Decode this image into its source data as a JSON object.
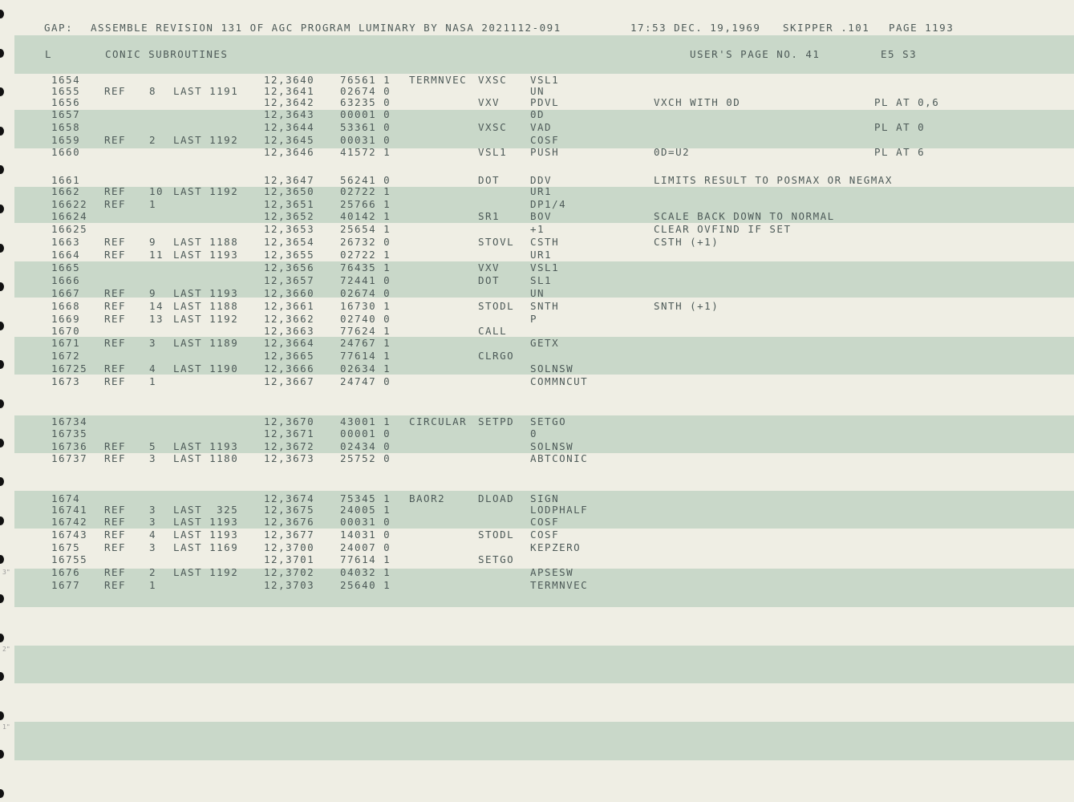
{
  "header": {
    "prefix": "GAP:",
    "assembly": "ASSEMBLE REVISION 131 OF AGC PROGRAM LUMINARY BY NASA 2021112-091",
    "timestamp": "17:53 DEC. 19,1969",
    "skipper": "SKIPPER .101",
    "page": "PAGE 1193"
  },
  "subheader": {
    "l": "L",
    "section": "CONIC SUBROUTINES",
    "user_page": "USER'S PAGE NO. 41",
    "code": "E5 S3"
  },
  "margin_ticks": [
    "3\"",
    "2\"",
    "1\""
  ],
  "rows": [
    {
      "n": "1654",
      "ref": "",
      "rn": "",
      "last": "",
      "addr": "12,3640",
      "oct": "76561 1",
      "label": "TERMNVEC",
      "op": "VXSC",
      "operand": "VSL1",
      "comment": "",
      "pl": ""
    },
    {
      "n": "1655",
      "ref": "REF",
      "rn": "8",
      "last": "LAST 1191",
      "addr": "12,3641",
      "oct": "02674 0",
      "label": "",
      "op": "",
      "operand": "UN",
      "comment": "",
      "pl": ""
    },
    {
      "n": "1656",
      "ref": "",
      "rn": "",
      "last": "",
      "addr": "12,3642",
      "oct": "63235 0",
      "label": "",
      "op": "VXV",
      "operand": "PDVL",
      "comment": "VXCH WITH 0D",
      "pl": "PL AT 0,6"
    },
    {
      "n": "1657",
      "ref": "",
      "rn": "",
      "last": "",
      "addr": "12,3643",
      "oct": "00001 0",
      "label": "",
      "op": "",
      "operand": "0D",
      "comment": "",
      "pl": ""
    },
    {
      "n": "1658",
      "ref": "",
      "rn": "",
      "last": "",
      "addr": "12,3644",
      "oct": "53361 0",
      "label": "",
      "op": "VXSC",
      "operand": "VAD",
      "comment": "",
      "pl": "PL AT 0"
    },
    {
      "n": "1659",
      "ref": "REF",
      "rn": "2",
      "last": "LAST 1192",
      "addr": "12,3645",
      "oct": "00031 0",
      "label": "",
      "op": "",
      "operand": "COSF",
      "comment": "",
      "pl": ""
    },
    {
      "n": "1660",
      "ref": "",
      "rn": "",
      "last": "",
      "addr": "12,3646",
      "oct": "41572 1",
      "label": "",
      "op": "VSL1",
      "operand": "PUSH",
      "comment": "0D=U2",
      "pl": "PL AT 6"
    },
    {
      "n": "1661",
      "ref": "",
      "rn": "",
      "last": "",
      "addr": "12,3647",
      "oct": "56241 0",
      "label": "",
      "op": "DOT",
      "operand": "DDV",
      "comment": "LIMITS RESULT TO POSMAX OR NEGMAX",
      "pl": ""
    },
    {
      "n": "1662",
      "ref": "REF",
      "rn": "10",
      "last": "LAST 1192",
      "addr": "12,3650",
      "oct": "02722 1",
      "label": "",
      "op": "",
      "operand": "UR1",
      "comment": "",
      "pl": ""
    },
    {
      "n": "16622",
      "ref": "REF",
      "rn": "1",
      "last": "",
      "addr": "12,3651",
      "oct": "25766 1",
      "label": "",
      "op": "",
      "operand": "DP1/4",
      "comment": "",
      "pl": ""
    },
    {
      "n": "16624",
      "ref": "",
      "rn": "",
      "last": "",
      "addr": "12,3652",
      "oct": "40142 1",
      "label": "",
      "op": "SR1",
      "operand": "BOV",
      "comment": "SCALE BACK DOWN TO NORMAL",
      "pl": ""
    },
    {
      "n": "16625",
      "ref": "",
      "rn": "",
      "last": "",
      "addr": "12,3653",
      "oct": "25654 1",
      "label": "",
      "op": "",
      "operand": "+1",
      "comment": "CLEAR OVFIND IF SET",
      "pl": ""
    },
    {
      "n": "1663",
      "ref": "REF",
      "rn": "9",
      "last": "LAST 1188",
      "addr": "12,3654",
      "oct": "26732 0",
      "label": "",
      "op": "STOVL",
      "operand": "CSTH",
      "comment": "CSTH (+1)",
      "pl": ""
    },
    {
      "n": "1664",
      "ref": "REF",
      "rn": "11",
      "last": "LAST 1193",
      "addr": "12,3655",
      "oct": "02722 1",
      "label": "",
      "op": "",
      "operand": "UR1",
      "comment": "",
      "pl": ""
    },
    {
      "n": "1665",
      "ref": "",
      "rn": "",
      "last": "",
      "addr": "12,3656",
      "oct": "76435 1",
      "label": "",
      "op": "VXV",
      "operand": "VSL1",
      "comment": "",
      "pl": ""
    },
    {
      "n": "1666",
      "ref": "",
      "rn": "",
      "last": "",
      "addr": "12,3657",
      "oct": "72441 0",
      "label": "",
      "op": "DOT",
      "operand": "SL1",
      "comment": "",
      "pl": ""
    },
    {
      "n": "1667",
      "ref": "REF",
      "rn": "9",
      "last": "LAST 1193",
      "addr": "12,3660",
      "oct": "02674 0",
      "label": "",
      "op": "",
      "operand": "UN",
      "comment": "",
      "pl": ""
    },
    {
      "n": "1668",
      "ref": "REF",
      "rn": "14",
      "last": "LAST 1188",
      "addr": "12,3661",
      "oct": "16730 1",
      "label": "",
      "op": "STODL",
      "operand": "SNTH",
      "comment": "SNTH (+1)",
      "pl": ""
    },
    {
      "n": "1669",
      "ref": "REF",
      "rn": "13",
      "last": "LAST 1192",
      "addr": "12,3662",
      "oct": "02740 0",
      "label": "",
      "op": "",
      "operand": "P",
      "comment": "",
      "pl": ""
    },
    {
      "n": "1670",
      "ref": "",
      "rn": "",
      "last": "",
      "addr": "12,3663",
      "oct": "77624 1",
      "label": "",
      "op": "CALL",
      "operand": "",
      "comment": "",
      "pl": ""
    },
    {
      "n": "1671",
      "ref": "REF",
      "rn": "3",
      "last": "LAST 1189",
      "addr": "12,3664",
      "oct": "24767 1",
      "label": "",
      "op": "",
      "operand": "GETX",
      "comment": "",
      "pl": ""
    },
    {
      "n": "1672",
      "ref": "",
      "rn": "",
      "last": "",
      "addr": "12,3665",
      "oct": "77614 1",
      "label": "",
      "op": "CLRGO",
      "operand": "",
      "comment": "",
      "pl": ""
    },
    {
      "n": "16725",
      "ref": "REF",
      "rn": "4",
      "last": "LAST 1190",
      "addr": "12,3666",
      "oct": "02634 1",
      "label": "",
      "op": "",
      "operand": "SOLNSW",
      "comment": "",
      "pl": ""
    },
    {
      "n": "1673",
      "ref": "REF",
      "rn": "1",
      "last": "",
      "addr": "12,3667",
      "oct": "24747 0",
      "label": "",
      "op": "",
      "operand": "COMMNCUT",
      "comment": "",
      "pl": ""
    },
    {
      "n": "16734",
      "ref": "",
      "rn": "",
      "last": "",
      "addr": "12,3670",
      "oct": "43001 1",
      "label": "CIRCULAR",
      "op": "SETPD",
      "operand": "SETGO",
      "comment": "",
      "pl": ""
    },
    {
      "n": "16735",
      "ref": "",
      "rn": "",
      "last": "",
      "addr": "12,3671",
      "oct": "00001 0",
      "label": "",
      "op": "",
      "operand": "0",
      "comment": "",
      "pl": ""
    },
    {
      "n": "16736",
      "ref": "REF",
      "rn": "5",
      "last": "LAST 1193",
      "addr": "12,3672",
      "oct": "02434 0",
      "label": "",
      "op": "",
      "operand": "SOLNSW",
      "comment": "",
      "pl": ""
    },
    {
      "n": "16737",
      "ref": "REF",
      "rn": "3",
      "last": "LAST 1180",
      "addr": "12,3673",
      "oct": "25752 0",
      "label": "",
      "op": "",
      "operand": "ABTCONIC",
      "comment": "",
      "pl": ""
    },
    {
      "n": "1674",
      "ref": "",
      "rn": "",
      "last": "",
      "addr": "12,3674",
      "oct": "75345 1",
      "label": "BAOR2",
      "op": "DLOAD",
      "operand": "SIGN",
      "comment": "",
      "pl": ""
    },
    {
      "n": "16741",
      "ref": "REF",
      "rn": "3",
      "last": "LAST  325",
      "addr": "12,3675",
      "oct": "24005 1",
      "label": "",
      "op": "",
      "operand": "LODPHALF",
      "comment": "",
      "pl": ""
    },
    {
      "n": "16742",
      "ref": "REF",
      "rn": "3",
      "last": "LAST 1193",
      "addr": "12,3676",
      "oct": "00031 0",
      "label": "",
      "op": "",
      "operand": "COSF",
      "comment": "",
      "pl": ""
    },
    {
      "n": "16743",
      "ref": "REF",
      "rn": "4",
      "last": "LAST 1193",
      "addr": "12,3677",
      "oct": "14031 0",
      "label": "",
      "op": "STODL",
      "operand": "COSF",
      "comment": "",
      "pl": ""
    },
    {
      "n": "1675",
      "ref": "REF",
      "rn": "3",
      "last": "LAST 1169",
      "addr": "12,3700",
      "oct": "24007 0",
      "label": "",
      "op": "",
      "operand": "KEPZERO",
      "comment": "",
      "pl": ""
    },
    {
      "n": "16755",
      "ref": "",
      "rn": "",
      "last": "",
      "addr": "12,3701",
      "oct": "77614 1",
      "label": "",
      "op": "SETGO",
      "operand": "",
      "comment": "",
      "pl": ""
    },
    {
      "n": "1676",
      "ref": "REF",
      "rn": "2",
      "last": "LAST 1192",
      "addr": "12,3702",
      "oct": "04032 1",
      "label": "",
      "op": "",
      "operand": "APSESW",
      "comment": "",
      "pl": ""
    },
    {
      "n": "1677",
      "ref": "REF",
      "rn": "1",
      "last": "",
      "addr": "12,3703",
      "oct": "25640 1",
      "label": "",
      "op": "",
      "operand": "TERMNVEC",
      "comment": "",
      "pl": ""
    }
  ]
}
